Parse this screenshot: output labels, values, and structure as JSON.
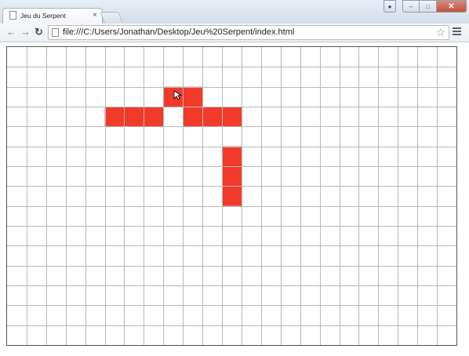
{
  "browser": {
    "tab_title": "Jeu du Serpent",
    "tab_close": "×",
    "url": "file:///C:/Users/Jonathan/Desktop/Jeu%20Serpent/index.html",
    "nav": {
      "back": "←",
      "forward": "→",
      "reload": "↻"
    },
    "star": "☆",
    "window": {
      "minimize": "–",
      "maximize": "□",
      "close": "✕"
    }
  },
  "game": {
    "grid": {
      "cols": 23,
      "rows": 15
    },
    "colors": {
      "snake": "#f23a2a",
      "grid_line": "#b8b8b8",
      "cursor": "#ffffff"
    },
    "snake": [
      [
        11,
        7
      ],
      [
        11,
        6
      ],
      [
        11,
        5
      ],
      [
        11,
        3
      ],
      [
        10,
        3
      ],
      [
        9,
        3
      ],
      [
        9,
        2
      ],
      [
        8,
        2
      ],
      [
        7,
        3
      ],
      [
        6,
        3
      ],
      [
        5,
        3
      ]
    ],
    "cursor_cell": [
      8,
      2
    ]
  }
}
